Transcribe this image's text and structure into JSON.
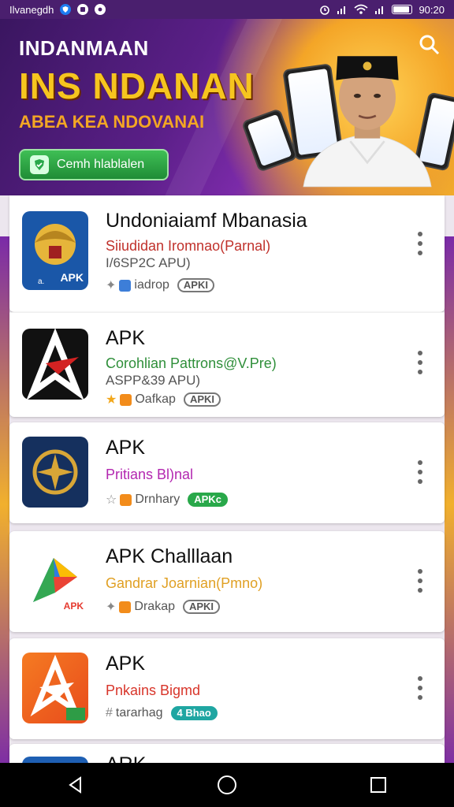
{
  "status_bar": {
    "app_label": "Ilvanegdh",
    "time": "90:20"
  },
  "banner": {
    "subtitle": "INDANMAAN",
    "title": "INS NDANAN",
    "tagline": "ABEA KEA NDOVANAI",
    "button_label": "Cemh hlablalen",
    "colors": {
      "title": "#f6c51f",
      "tagline": "#f3a624",
      "button": "#29a84a"
    }
  },
  "apps": [
    {
      "name": "Undoniaiamf Mbanasia",
      "developer": "Siiudidan Iromnao(Parnal)",
      "developer_color": "#c0312b",
      "subtitle": "I/6SP2C APU)",
      "meta": "iadrop",
      "badge": "APKI",
      "icon": "garuda-icon",
      "icon_label": "APK"
    },
    {
      "name": "APK",
      "developer": "Corohlian Pattrons@V.Pre)",
      "developer_color": "#2f8f3a",
      "subtitle": "ASPP&39 APU)",
      "meta": "Oafkap",
      "badge": "APKI",
      "icon": "star-a-icon"
    },
    {
      "name": "APK",
      "developer": "Pritians Bl)nal",
      "developer_color": "#b327b0",
      "subtitle": "",
      "meta": "Drnhary",
      "badge": "APKc",
      "icon": "compass-icon"
    },
    {
      "name": "APK Challlaan",
      "developer": "Gandrar Joarnian(Pmno)",
      "developer_color": "#e0a024",
      "subtitle": "",
      "meta": "Drakap",
      "badge": "APKI",
      "icon": "play-apk-icon",
      "icon_label": "APK"
    },
    {
      "name": "APK",
      "developer": "Pnkains Bigmd",
      "developer_color": "#d8352a",
      "subtitle": "",
      "meta": "tararhag",
      "badge": "4 Bhao",
      "icon": "orange-star-icon"
    },
    {
      "name": "ARK",
      "developer": "",
      "subtitle": "",
      "meta": "",
      "badge": "",
      "icon": "blue-app-icon"
    }
  ]
}
